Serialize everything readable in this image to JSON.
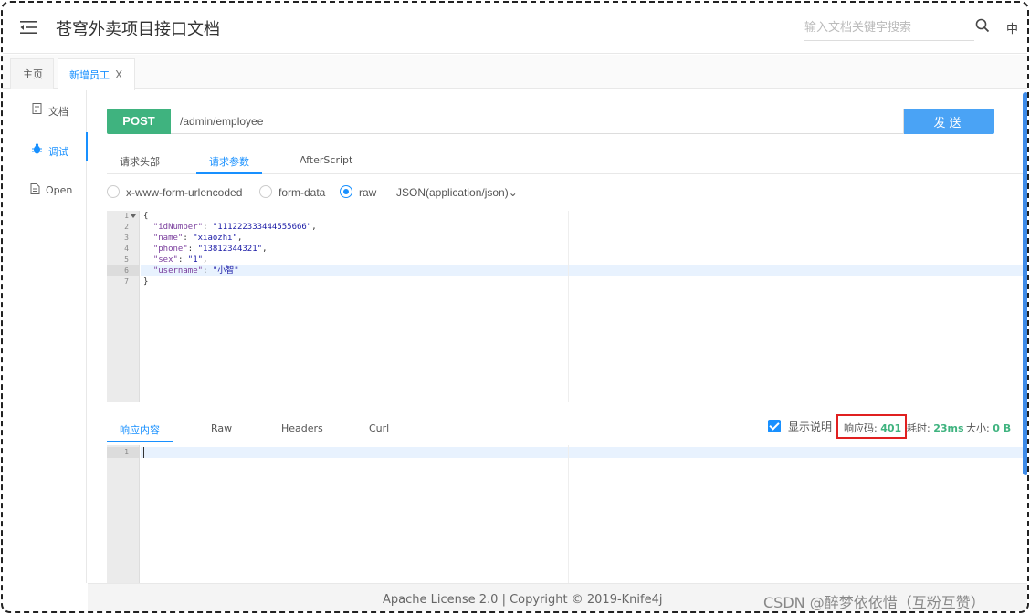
{
  "header": {
    "title": "苍穹外卖项目接口文档",
    "search_placeholder": "输入文档关键字搜索",
    "lang": "中"
  },
  "tabs": [
    {
      "label": "主页"
    },
    {
      "label": "新增员工",
      "close": "X"
    }
  ],
  "sidebar": {
    "items": [
      {
        "label": "文档",
        "icon": "document-icon"
      },
      {
        "label": "调试",
        "icon": "bug-icon"
      },
      {
        "label": "Open",
        "icon": "file-icon"
      }
    ]
  },
  "request": {
    "method": "POST",
    "url": "/admin/employee",
    "send_label": "发送"
  },
  "request_tabs": [
    "请求头部",
    "请求参数",
    "AfterScript"
  ],
  "body_modes": [
    "x-www-form-urlencoded",
    "form-data",
    "raw"
  ],
  "selected_mode": "raw",
  "content_type": "JSON(application/json)",
  "content_type_arrow": "⌄",
  "editor": {
    "lines": [
      "1",
      "2",
      "3",
      "4",
      "5",
      "6",
      "7"
    ],
    "code": {
      "open": "{",
      "idNumber_key": "\"idNumber\"",
      "idNumber_val": "\"111222333444555666\"",
      "name_key": "\"name\"",
      "name_val": "\"xiaozhi\"",
      "phone_key": "\"phone\"",
      "phone_val": "\"13812344321\"",
      "sex_key": "\"sex\"",
      "sex_val": "\"1\"",
      "username_key": "\"username\"",
      "username_val": "\"小智\"",
      "close": "}"
    }
  },
  "response": {
    "tabs": [
      "响应内容",
      "Raw",
      "Headers",
      "Curl"
    ],
    "show_desc_label": "显示说明",
    "status_label": "响应码:",
    "status_code": "401",
    "time_label": "耗时:",
    "time_value": "23ms",
    "size_label": "大小:",
    "size_value": "0 B",
    "lines": [
      "1"
    ]
  },
  "footer": {
    "license": "Apache License 2.0 | Copyright © 2019-Knife4j",
    "watermark": "CSDN @醉梦依依惜（互粉互赞）"
  },
  "colors": {
    "accent": "#1890ff",
    "method_post": "#3fb37f",
    "send_button": "#4aa3f5",
    "status_highlight": "#e02020"
  }
}
